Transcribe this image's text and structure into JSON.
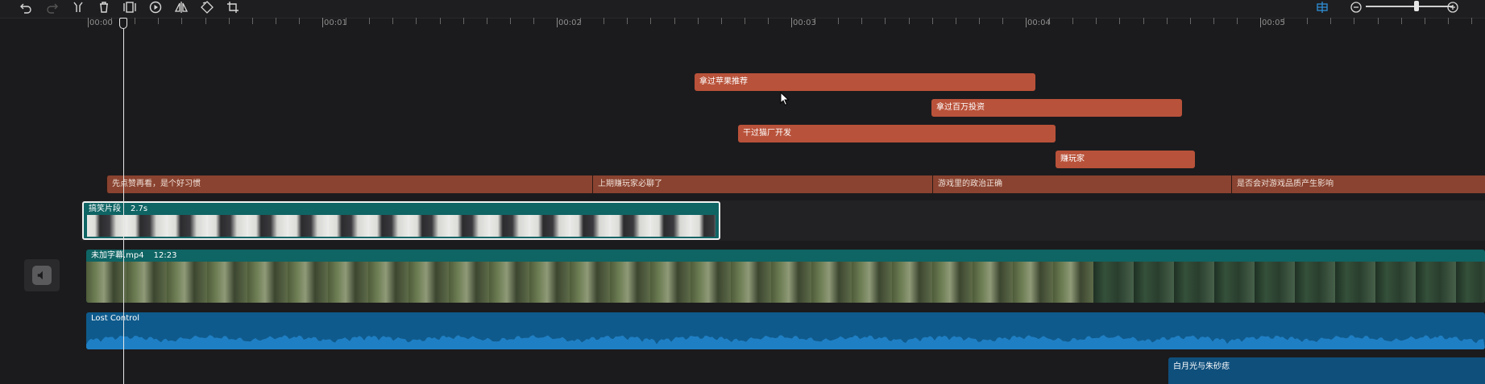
{
  "toolbar": {
    "icons": [
      "undo-icon",
      "redo-icon",
      "split-icon",
      "delete-icon",
      "freeze-frame-icon",
      "play-icon",
      "mirror-icon",
      "rotate-icon",
      "crop-icon"
    ],
    "snap_icon": "snap-icon",
    "zoom_out_icon": "zoom-out-icon",
    "zoom_in_icon": "zoom-in-icon",
    "zoom_level": 0.6
  },
  "ruler": {
    "labels": [
      "00:00",
      "00:01",
      "00:02",
      "00:03",
      "00:04",
      "00:05"
    ]
  },
  "text_clips": [
    {
      "label": "拿过苹果推荐"
    },
    {
      "label": "拿过百万投资"
    },
    {
      "label": "干过猫厂开发"
    },
    {
      "label": "赚玩家"
    }
  ],
  "subtitles": [
    {
      "label": "先点赞再看，是个好习惯"
    },
    {
      "label": "上期赚玩家必聊了"
    },
    {
      "label": "游戏里的政治正确"
    },
    {
      "label": "是否会对游戏品质产生影响"
    }
  ],
  "video_clip_1": {
    "name": "搞笑片段",
    "duration": "2.7s"
  },
  "video_clip_2": {
    "name": "未加字幕.mp4",
    "duration": "12:23"
  },
  "audio_clip_1": {
    "name": "Lost Control"
  },
  "audio_clip_2": {
    "name": "白月光与朱砂痣"
  },
  "colors": {
    "text_clip": "#b9523a",
    "subtitle": "#8a4330",
    "video": "#0f6464",
    "audio": "#0f5a8c",
    "accent": "#2f8fd8"
  }
}
